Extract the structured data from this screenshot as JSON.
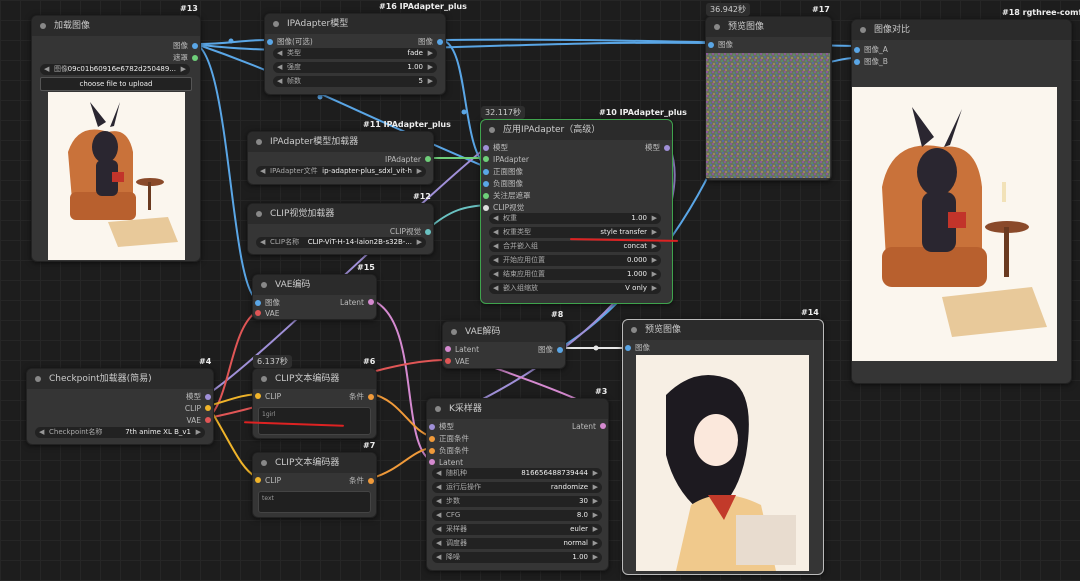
{
  "colors": {
    "blue": "#5aa6e6",
    "pink": "#d58ad0",
    "red": "#e05656",
    "yellow": "#f0b42a",
    "green": "#6fcf7a",
    "teal": "#6ac2c2",
    "lavender": "#a090d8",
    "white": "#e8e8e8"
  },
  "nodes": {
    "load_image": {
      "title": "加载图像",
      "id": "#13",
      "out_image": "图像",
      "out_mask": "遮罩",
      "image_widget_label": "图像",
      "image_widget_value": "09c01b60916e6782d250489...",
      "upload_label": "choose file to upload"
    },
    "ipa_style": {
      "title": "IPAdapter模型",
      "id": "#16 IPAdapter_plus",
      "in_image": "图像(可选)",
      "out_image": "图像",
      "w_type_label": "类型",
      "w_type_value": "fade",
      "w_strength_label": "强度",
      "w_strength_value": "1.00",
      "w_frames_label": "帧数",
      "w_frames_value": "5"
    },
    "preview_top": {
      "title": "预览图像",
      "id": "#17",
      "time": "36.942秒",
      "in_image": "图像"
    },
    "compare": {
      "title": "图像对比",
      "id": "#18 rgthree-comfy",
      "in_a": "图像_A",
      "in_b": "图像_B"
    },
    "ipa_loader": {
      "title": "IPAdapter模型加载器",
      "id": "#11 IPAdapter_plus",
      "out": "IPAdapter",
      "w_label": "IPAdapter文件",
      "w_value": "ip-adapter-plus_sdxl_vit-h"
    },
    "clip_vision": {
      "title": "CLIP视觉加载器",
      "id": "#12",
      "out": "CLIP视觉",
      "w_label": "CLIP名称",
      "w_value": "CLIP-ViT-H-14-laion2B-s32B-..."
    },
    "apply_ipa": {
      "title": "应用IPAdapter（高级）",
      "id": "#10 IPAdapter_plus",
      "time": "32.117秒",
      "inputs": [
        "模型",
        "IPAdapter",
        "正面图像",
        "负面图像",
        "关注层遮罩",
        "CLIP视觉"
      ],
      "out": "模型",
      "widgets": [
        {
          "label": "权重",
          "value": "1.00"
        },
        {
          "label": "权重类型",
          "value": "style transfer"
        },
        {
          "label": "合并嵌入组",
          "value": "concat"
        },
        {
          "label": "开始应用位置",
          "value": "0.000"
        },
        {
          "label": "结束应用位置",
          "value": "1.000"
        },
        {
          "label": "嵌入组缩放",
          "value": "V only"
        }
      ]
    },
    "vae_encode": {
      "title": "VAE编码",
      "id": "#15",
      "in_image": "图像",
      "in_vae": "VAE",
      "out": "Latent"
    },
    "vae_decode": {
      "title": "VAE解码",
      "id": "#8",
      "in_latent": "Latent",
      "in_vae": "VAE",
      "out": "图像"
    },
    "preview_bottom": {
      "title": "预览图像",
      "id": "#14",
      "in_image": "图像"
    },
    "checkpoint": {
      "title": "Checkpoint加载器(简易)",
      "id": "#4",
      "outs": [
        "模型",
        "CLIP",
        "VAE"
      ],
      "w_label": "Checkpoint名称",
      "w_value": "7th anime XL B_v1"
    },
    "clip_text_pos": {
      "title": "CLIP文本编码器",
      "id": "#6",
      "time": "6.137秒",
      "in": "CLIP",
      "out": "条件",
      "text": "1girl"
    },
    "clip_text_neg": {
      "title": "CLIP文本编码器",
      "id": "#7",
      "in": "CLIP",
      "out": "条件",
      "text": "text"
    },
    "ksampler": {
      "title": "K采样器",
      "id": "#3",
      "inputs": [
        "模型",
        "正面条件",
        "负面条件",
        "Latent"
      ],
      "out": "Latent",
      "widgets": [
        {
          "label": "随机种",
          "value": "816656488739444"
        },
        {
          "label": "运行后操作",
          "value": "randomize"
        },
        {
          "label": "步数",
          "value": "30"
        },
        {
          "label": "CFG",
          "value": "8.0"
        },
        {
          "label": "采样器",
          "value": "euler"
        },
        {
          "label": "调度器",
          "value": "normal"
        },
        {
          "label": "降噪",
          "value": "1.00"
        }
      ]
    }
  },
  "images": {
    "bat_reading": "bat character reading in armchair",
    "anime_girl": "anime girl with dark hair",
    "noise": "noise preview"
  }
}
